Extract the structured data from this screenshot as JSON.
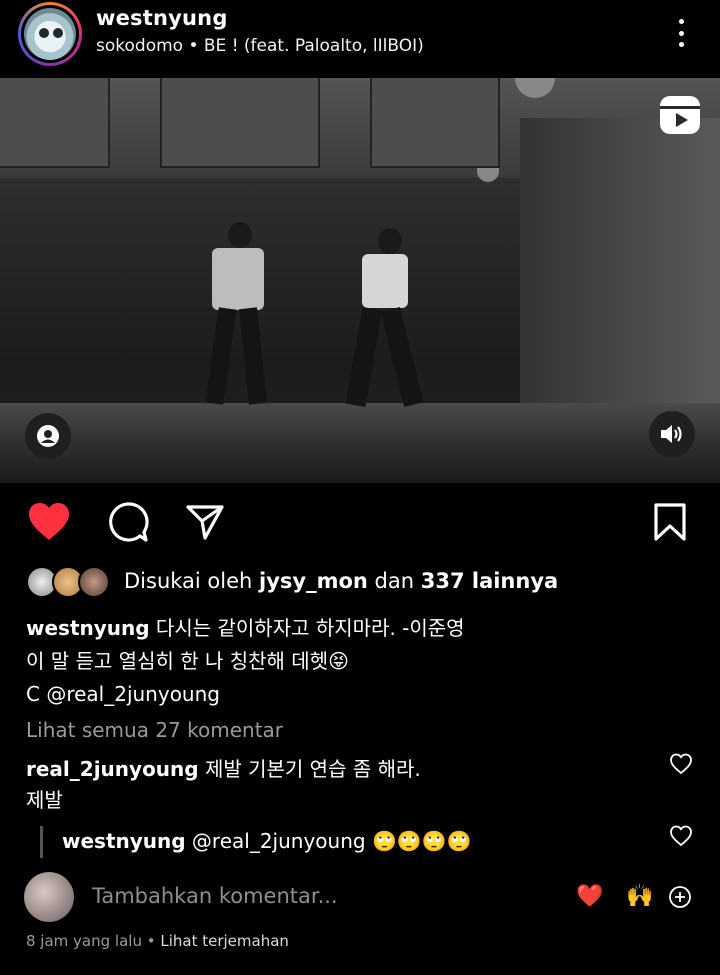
{
  "header": {
    "username": "westnyung",
    "song": "sokodomo • BE ! (feat. Paloalto, lIlBOI)"
  },
  "actions": {
    "liked": true,
    "like_color": "#ff3040"
  },
  "likes": {
    "prefix": "Disukai oleh ",
    "user": "jysy_mon",
    "middle": " dan ",
    "count": "337 lainnya"
  },
  "caption": {
    "username": "westnyung",
    "line1": " 다시는 같이하자고 하지마라. -이준영",
    "line2": "이 말 듣고 열심히 한 나 칭찬해 데헷😝",
    "line3": "C @real_2junyoung"
  },
  "view_all": "Lihat semua 27 komentar",
  "comment": {
    "username": "real_2junyoung",
    "text": " 제발 기본기 연습 좀 해라.",
    "text2": "제발"
  },
  "reply": {
    "username": "westnyung",
    "text": " @real_2junyoung 🙄🙄🙄🙄"
  },
  "add_comment": {
    "placeholder": "Tambahkan komentar...",
    "emoji1": "❤️",
    "emoji2": "🙌"
  },
  "meta": {
    "time": "8 jam yang lalu",
    "sep": " • ",
    "translate": "Lihat terjemahan"
  }
}
